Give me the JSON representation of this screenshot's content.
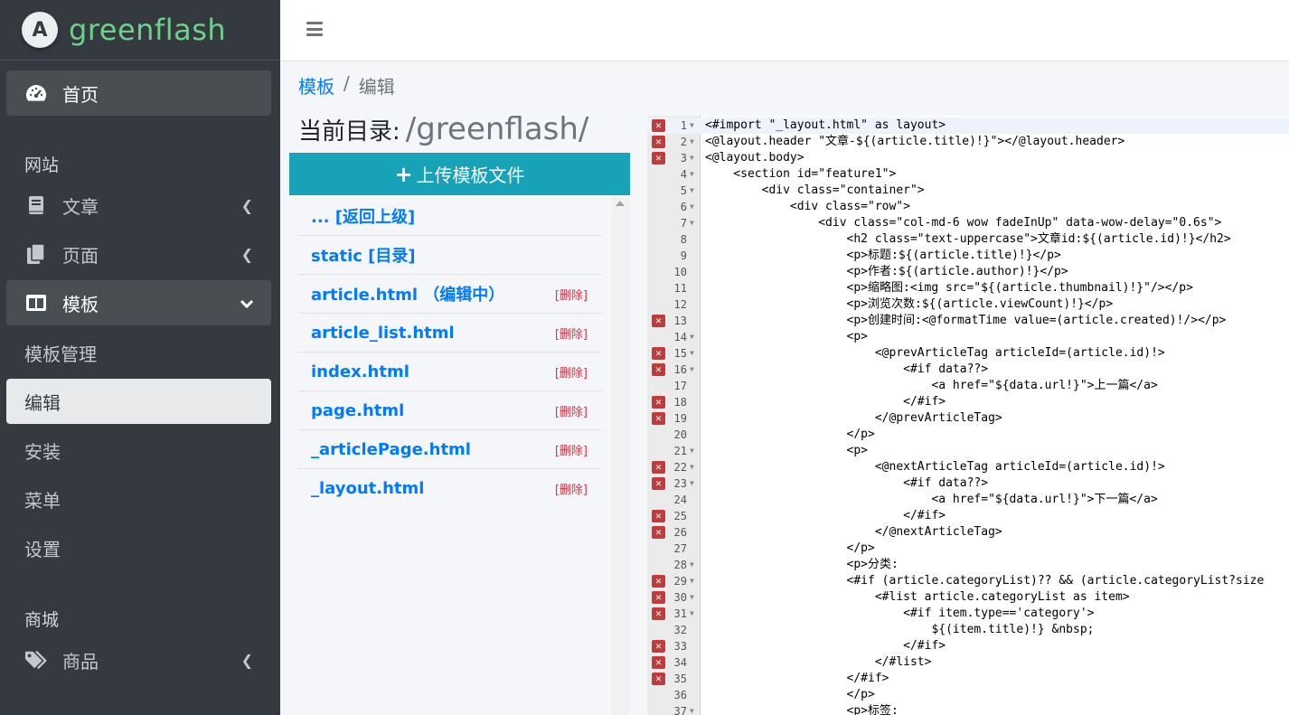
{
  "brand": {
    "logo_letter": "A",
    "name": "greenflash"
  },
  "sidebar": {
    "home": "首页",
    "section_site": "网站",
    "article": "文章",
    "page": "页面",
    "template": "模板",
    "template_manage": "模板管理",
    "edit": "编辑",
    "install": "安装",
    "menu": "菜单",
    "settings": "设置",
    "section_mall": "商城",
    "product": "商品"
  },
  "breadcrumb": {
    "parent": "模板",
    "sep": "/",
    "current": "编辑"
  },
  "current_dir": {
    "label": "当前目录:",
    "path": "/greenflash/"
  },
  "upload_label": "上传模板文件",
  "files": [
    {
      "name": "... [返回上级]",
      "del": ""
    },
    {
      "name": "static [目录]",
      "del": ""
    },
    {
      "name": "article.html （编辑中）",
      "del": "[删除]"
    },
    {
      "name": "article_list.html",
      "del": "[删除]"
    },
    {
      "name": "index.html",
      "del": "[删除]"
    },
    {
      "name": "page.html",
      "del": "[删除]"
    },
    {
      "name": "_articlePage.html",
      "del": "[删除]"
    },
    {
      "name": "_layout.html",
      "del": "[删除]"
    }
  ],
  "editor": {
    "error_mark": "✕",
    "lines": [
      {
        "n": "1",
        "err": true,
        "fold": true,
        "code": "<#import \"_layout.html\" as layout>"
      },
      {
        "n": "2",
        "err": true,
        "fold": true,
        "code": "<@layout.header \"文章-${(article.title)!}\"></@layout.header>"
      },
      {
        "n": "3",
        "err": true,
        "fold": true,
        "code": "<@layout.body>"
      },
      {
        "n": "4",
        "err": false,
        "fold": true,
        "code": "    <section id=\"feature1\">"
      },
      {
        "n": "5",
        "err": false,
        "fold": true,
        "code": "        <div class=\"container\">"
      },
      {
        "n": "6",
        "err": false,
        "fold": true,
        "code": "            <div class=\"row\">"
      },
      {
        "n": "7",
        "err": false,
        "fold": true,
        "code": "                <div class=\"col-md-6 wow fadeInUp\" data-wow-delay=\"0.6s\">"
      },
      {
        "n": "8",
        "err": false,
        "fold": false,
        "code": "                    <h2 class=\"text-uppercase\">文章id:${(article.id)!}</h2>"
      },
      {
        "n": "9",
        "err": false,
        "fold": false,
        "code": "                    <p>标题:${(article.title)!}</p>"
      },
      {
        "n": "10",
        "err": false,
        "fold": false,
        "code": "                    <p>作者:${(article.author)!}</p>"
      },
      {
        "n": "11",
        "err": false,
        "fold": false,
        "code": "                    <p>缩略图:<img src=\"${(article.thumbnail)!}\"/></p>"
      },
      {
        "n": "12",
        "err": false,
        "fold": false,
        "code": "                    <p>浏览次数:${(article.viewCount)!}</p>"
      },
      {
        "n": "13",
        "err": true,
        "fold": false,
        "code": "                    <p>创建时间:<@formatTime value=(article.created)!/></p>"
      },
      {
        "n": "14",
        "err": false,
        "fold": true,
        "code": "                    <p>"
      },
      {
        "n": "15",
        "err": true,
        "fold": true,
        "code": "                        <@prevArticleTag articleId=(article.id)!>"
      },
      {
        "n": "16",
        "err": true,
        "fold": true,
        "code": "                            <#if data??>"
      },
      {
        "n": "17",
        "err": false,
        "fold": false,
        "code": "                                <a href=\"${data.url!}\">上一篇</a>"
      },
      {
        "n": "18",
        "err": true,
        "fold": false,
        "code": "                            </#if>"
      },
      {
        "n": "19",
        "err": true,
        "fold": false,
        "code": "                        </@prevArticleTag>"
      },
      {
        "n": "20",
        "err": false,
        "fold": false,
        "code": "                    </p>"
      },
      {
        "n": "21",
        "err": false,
        "fold": true,
        "code": "                    <p>"
      },
      {
        "n": "22",
        "err": true,
        "fold": true,
        "code": "                        <@nextArticleTag articleId=(article.id)!>"
      },
      {
        "n": "23",
        "err": true,
        "fold": true,
        "code": "                            <#if data??>"
      },
      {
        "n": "24",
        "err": false,
        "fold": false,
        "code": "                                <a href=\"${data.url!}\">下一篇</a>"
      },
      {
        "n": "25",
        "err": true,
        "fold": false,
        "code": "                            </#if>"
      },
      {
        "n": "26",
        "err": true,
        "fold": false,
        "code": "                        </@nextArticleTag>"
      },
      {
        "n": "27",
        "err": false,
        "fold": false,
        "code": "                    </p>"
      },
      {
        "n": "28",
        "err": false,
        "fold": true,
        "code": "                    <p>分类:"
      },
      {
        "n": "29",
        "err": true,
        "fold": true,
        "code": "                    <#if (article.categoryList)?? && (article.categoryList?size"
      },
      {
        "n": "30",
        "err": true,
        "fold": true,
        "code": "                        <#list article.categoryList as item>"
      },
      {
        "n": "31",
        "err": true,
        "fold": true,
        "code": "                            <#if item.type=='category'>"
      },
      {
        "n": "32",
        "err": false,
        "fold": false,
        "code": "                                ${(item.title)!} &nbsp;"
      },
      {
        "n": "33",
        "err": true,
        "fold": false,
        "code": "                            </#if>"
      },
      {
        "n": "34",
        "err": true,
        "fold": false,
        "code": "                        </#list>"
      },
      {
        "n": "35",
        "err": true,
        "fold": false,
        "code": "                    </#if>"
      },
      {
        "n": "36",
        "err": false,
        "fold": false,
        "code": "                    </p>"
      },
      {
        "n": "37",
        "err": false,
        "fold": true,
        "code": "                    <p>标签:"
      }
    ]
  }
}
